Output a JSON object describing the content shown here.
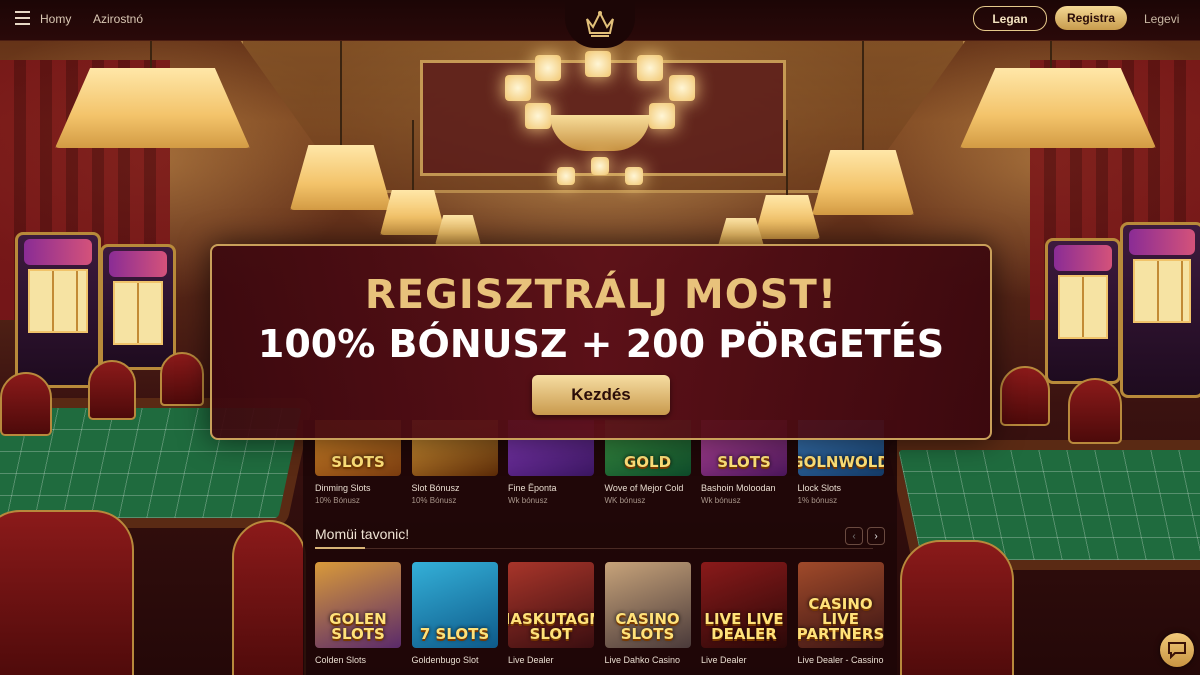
{
  "topbar": {
    "menu_icon": "hamburger-icon",
    "nav": [
      "Homy",
      "Azirostnó"
    ],
    "logo_icon": "crown-logo-icon",
    "login_label": "Legan",
    "register_label": "Registra",
    "right_link": "Legevi"
  },
  "banner": {
    "headline": "REGISZTRÁLJ MOST!",
    "subline": "100% BÓNUSZ + 200 PÖRGETÉS",
    "cta_label": "Kezdés"
  },
  "row1": [
    {
      "thumb_text": "SLOTS",
      "title": "Dinming Slots",
      "sub": "10% Bónusz",
      "colors": [
        "#7a3c10",
        "#d98c2a"
      ]
    },
    {
      "thumb_text": "",
      "title": "Slot Bónusz",
      "sub": "10% Bónusz",
      "colors": [
        "#5a2a08",
        "#e2a23a"
      ]
    },
    {
      "thumb_text": "",
      "title": "Fine Ëponta",
      "sub": "Wk bónusz",
      "colors": [
        "#3a1660",
        "#8a3cbf"
      ]
    },
    {
      "thumb_text": "GOLD",
      "title": "Wove of Mejor Cold",
      "sub": "WK bónusz",
      "colors": [
        "#0e4a2a",
        "#3f9a44"
      ]
    },
    {
      "thumb_text": "SLOTS",
      "title": "Bashoin Moloodan",
      "sub": "Wk bónusz",
      "colors": [
        "#4a165a",
        "#c04aa0"
      ]
    },
    {
      "thumb_text": "GOLNWOLD",
      "title": "Llock Slots",
      "sub": "1% bónusz",
      "colors": [
        "#143a66",
        "#3f7fc0"
      ]
    }
  ],
  "section": {
    "title": "Momüi tavonic!",
    "prev_icon": "chevron-left-icon",
    "next_icon": "chevron-right-icon"
  },
  "row2": [
    {
      "thumb_text": "GOLEN SLOTS",
      "title": "Colden Slots",
      "colors": [
        "#5a2a6a",
        "#d99a3a"
      ]
    },
    {
      "thumb_text": "7 SLOTS",
      "title": "Goldenbugo Slot",
      "colors": [
        "#0e5a8a",
        "#34b0d8"
      ]
    },
    {
      "thumb_text": "NASKUTAGM SLOT",
      "title": "Live Dealer",
      "colors": [
        "#3a0e10",
        "#a8352a"
      ]
    },
    {
      "thumb_text": "CASINO SLOTS",
      "title": "Live Dahko Casino",
      "colors": [
        "#4a3a3a",
        "#c7a37a"
      ]
    },
    {
      "thumb_text": "LIVE LIVE DEALER",
      "title": "Live Dealer",
      "colors": [
        "#2a0808",
        "#8a1a1a"
      ]
    },
    {
      "thumb_text": "CASINO LIVE PARTNERS",
      "title": "Live Dealer - Cassino",
      "colors": [
        "#3a1414",
        "#a04a2a"
      ]
    }
  ],
  "chat_icon": "chat-bubble-icon",
  "colors": {
    "gold": "#d8b477",
    "burgundy": "#5c1018"
  }
}
